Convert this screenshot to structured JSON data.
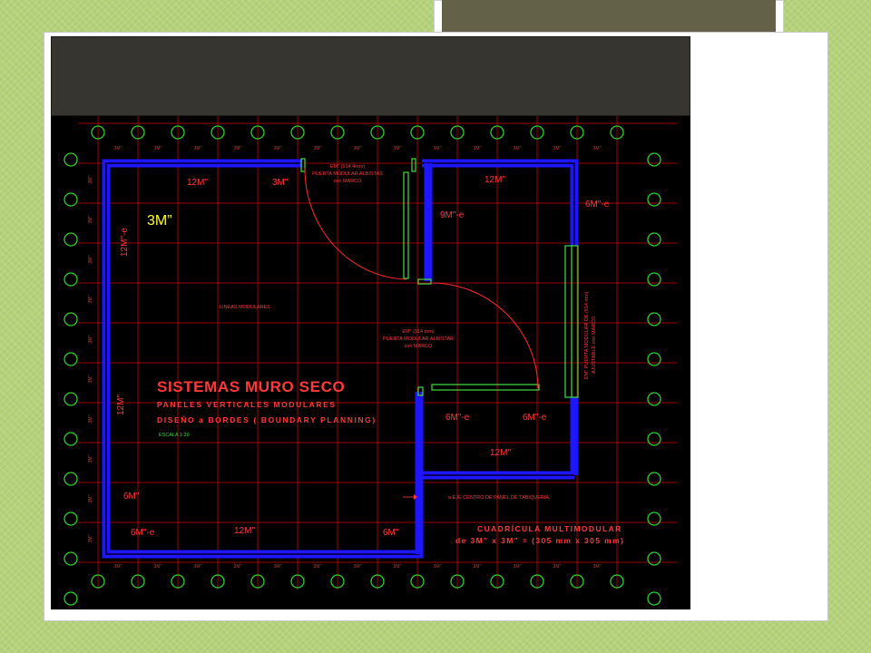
{
  "slide": {
    "scale_callout": "3M”"
  },
  "plan": {
    "title": "SISTEMAS MURO SECO",
    "subtitle_1": "PANELES VERTICALES MODULARES",
    "subtitle_2": "DISEÑO a BORDES ( BOUNDARY PLANNING)",
    "scale_note": "ESCALA 1:20",
    "grid_caption_1": "CUADRÍCULA MULTIMODULAR",
    "grid_caption_2": "de 3M\" x 3M\" = (305 mm x 305 mm)",
    "tick_label": "3M\"",
    "small_room_label": "LINEAS MODULARES",
    "wall_center_note": "a EJE CENTRO DE PANEL DE TABIQUERIA",
    "door_top": [
      "EM\" (914.4mm)",
      "PUERTA MODULAR ALBISTAS",
      "con MARCO"
    ],
    "door_mid": [
      "EM\" (914 mm)",
      "PUERTA MODULAR ALBISTAR",
      "con MARCO"
    ],
    "door_right": [
      "EM\" PUERTA MODULAR DE (914 mm)",
      "AJUSTABLE con MARCO"
    ],
    "dimensions": {
      "top_left_12": "12M\"",
      "top_left_3": "3M\"",
      "top_right_12": "12M\"",
      "right_6e": "6M\"-e",
      "inner_9e": "9M\"-e",
      "left_12e": "12M\"-e",
      "left_12": "12M\"",
      "mid_6e_a": "6M\"-e",
      "mid_6e_b": "6M\"-e",
      "lower_12": "12M\"",
      "left_6": "6M\"",
      "bottom_6e": "6M\"-e",
      "bottom_12": "12M\"",
      "bottom_6": "6M\""
    }
  },
  "colors": {
    "slide_background": "#b4d27a",
    "cad_background": "#000000",
    "grid_red": "#cc0000",
    "wall_blue": "#1d16ff",
    "node_green": "#2ccf2c",
    "text_red": "#ff3a3a",
    "callout_yellow": "#ffff33",
    "header_band": "#363530"
  },
  "icons": [
    "grid-node-circle",
    "arrow-pointer-icon"
  ]
}
